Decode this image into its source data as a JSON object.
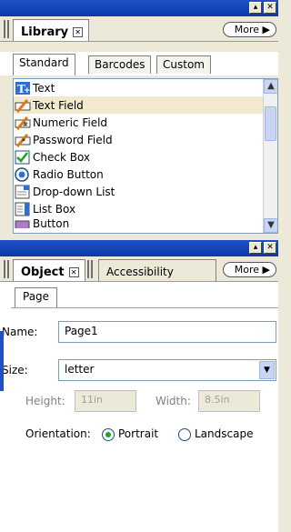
{
  "library_panel": {
    "tab_label": "Library",
    "more_label": "More",
    "subtabs": [
      "Standard",
      "Barcodes",
      "Custom"
    ],
    "items": [
      {
        "label": "Text",
        "icon": "text-tool-icon"
      },
      {
        "label": "Text Field",
        "icon": "text-field-icon"
      },
      {
        "label": "Numeric Field",
        "icon": "numeric-field-icon"
      },
      {
        "label": "Password Field",
        "icon": "password-field-icon"
      },
      {
        "label": "Check Box",
        "icon": "check-box-icon"
      },
      {
        "label": "Radio Button",
        "icon": "radio-button-icon"
      },
      {
        "label": "Drop-down List",
        "icon": "drop-down-list-icon"
      },
      {
        "label": "List Box",
        "icon": "list-box-icon"
      },
      {
        "label": "Button",
        "icon": "button-icon"
      }
    ],
    "selected_index": 1
  },
  "object_panel": {
    "tab_label": "Object",
    "tab2_label": "Accessibility",
    "more_label": "More",
    "subtab": "Page",
    "name_label": "Name:",
    "name_value": "Page1",
    "size_label": "Size:",
    "size_value": "letter",
    "height_label": "Height:",
    "height_value": "11in",
    "width_label": "Width:",
    "width_value": "8.5in",
    "orientation_label": "Orientation:",
    "portrait_label": "Portrait",
    "landscape_label": "Landscape",
    "orientation_selected": "Portrait"
  },
  "colors": {
    "titlebar": "#0a3aa8",
    "selection": "#f2e9cf",
    "panel": "#ece9d8"
  }
}
